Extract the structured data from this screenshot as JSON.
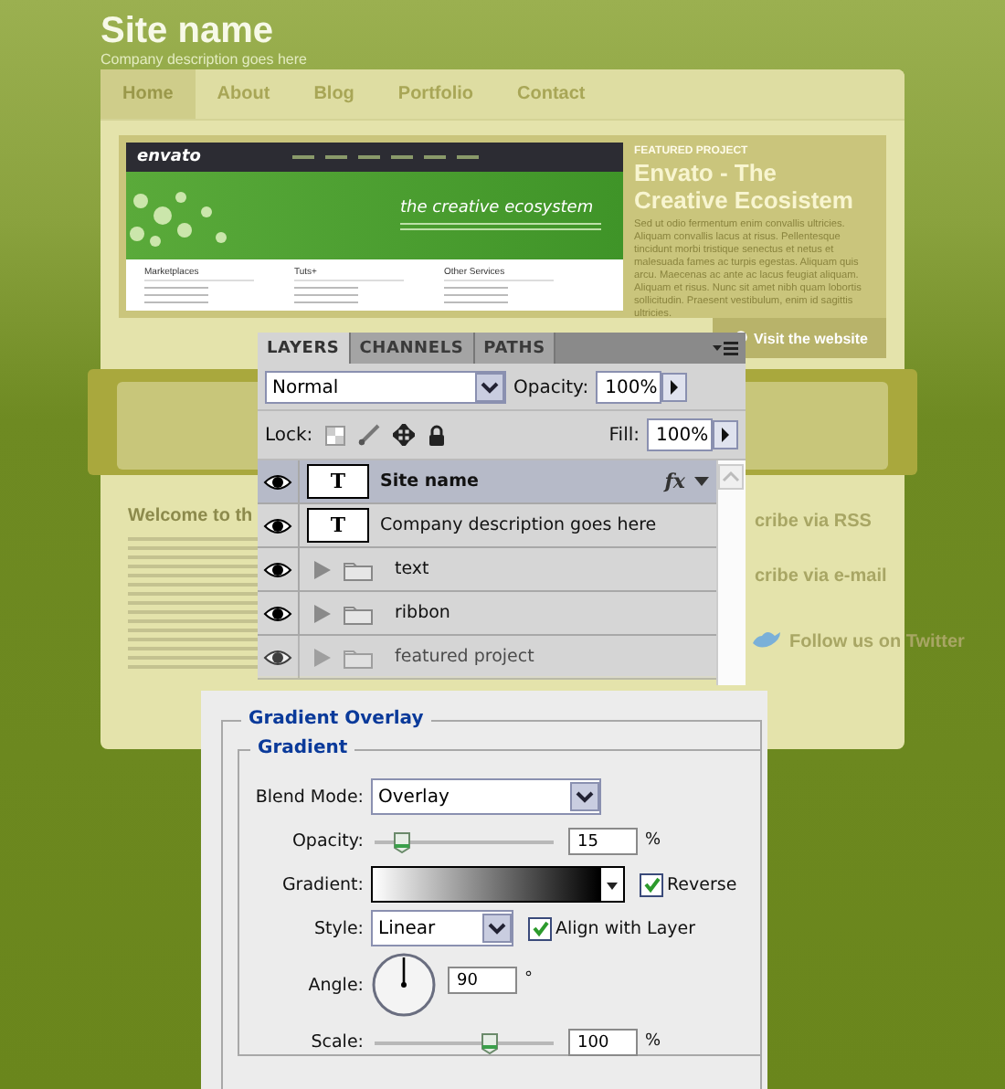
{
  "site": {
    "title": "Site name",
    "tagline": "Company description goes here",
    "nav": [
      {
        "label": "Home",
        "selected": true
      },
      {
        "label": "About",
        "selected": false
      },
      {
        "label": "Blog",
        "selected": false
      },
      {
        "label": "Portfolio",
        "selected": false
      },
      {
        "label": "Contact",
        "selected": false
      }
    ],
    "featured": {
      "eyebrow": "FEATURED PROJECT",
      "title": "Envato - The Creative Ecosistem",
      "body": "Sed ut odio fermentum enim convallis ultricies. Aliquam convallis lacus at risus. Pellentesque tincidunt morbi tristique senectus et netus et malesuada fames ac turpis egestas. Aliquam quis arcu. Maecenas ac ante ac lacus feugiat aliquam. Aliquam et risus. Nunc sit amet nibh quam lobortis sollicitudin. Praesent vestibulum, enim id sagittis ultricies.",
      "link": "Visit the website",
      "preview": {
        "logo": "envato",
        "headline": "the creative ecosystem",
        "columns": [
          "Marketplaces",
          "Tuts+",
          "Other Services"
        ]
      }
    },
    "welcome": "Welcome to th",
    "sidebar_links": [
      {
        "kind": "rss",
        "label": "cribe via RSS"
      },
      {
        "kind": "email",
        "label": "cribe via e-mail"
      },
      {
        "kind": "twitter",
        "label": "Follow us on Twitter"
      }
    ]
  },
  "layers_panel": {
    "tabs": [
      {
        "label": "LAYERS",
        "selected": true
      },
      {
        "label": "CHANNELS",
        "selected": false
      },
      {
        "label": "PATHS",
        "selected": false
      }
    ],
    "blend_mode": "Normal",
    "opacity_label": "Opacity:",
    "opacity": "100%",
    "lock_label": "Lock:",
    "fill_label": "Fill:",
    "fill": "100%",
    "layers": [
      {
        "kind": "text",
        "thumb": "T",
        "name": "Site name",
        "visible": true,
        "selected": true,
        "effects": "fx"
      },
      {
        "kind": "text",
        "thumb": "T",
        "name": "Company description goes here",
        "visible": true,
        "selected": false
      },
      {
        "kind": "group",
        "name": "text",
        "visible": true,
        "selected": false
      },
      {
        "kind": "group",
        "name": "ribbon",
        "visible": true,
        "selected": false
      },
      {
        "kind": "group",
        "name": "featured project",
        "visible": true,
        "selected": false
      }
    ]
  },
  "gradient_overlay": {
    "title": "Gradient Overlay",
    "group": "Gradient",
    "blend_mode": {
      "label": "Blend Mode:",
      "value": "Overlay"
    },
    "opacity": {
      "label": "Opacity:",
      "value": "15",
      "unit": "%",
      "level": 0.15
    },
    "gradient": {
      "label": "Gradient:",
      "reverse": {
        "label": "Reverse",
        "checked": true
      }
    },
    "style": {
      "label": "Style:",
      "value": "Linear",
      "align": {
        "label": "Align with Layer",
        "checked": true
      }
    },
    "angle": {
      "label": "Angle:",
      "value": "90",
      "unit": "°"
    },
    "scale": {
      "label": "Scale:",
      "value": "100",
      "unit": "%",
      "level": 0.64
    }
  }
}
